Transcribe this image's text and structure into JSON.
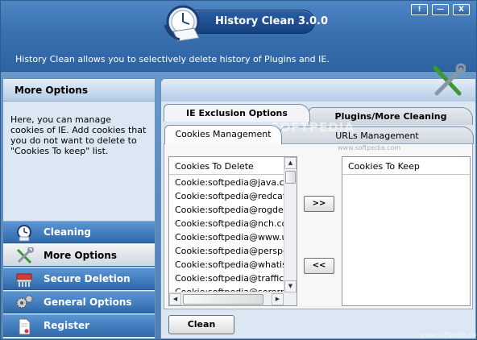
{
  "window": {
    "title": "History Clean 3.0.0",
    "subtitle": "History Clean allows you to selectively delete history of Plugins and IE.",
    "controls": {
      "info": "!",
      "minimize": "—",
      "close": "X"
    }
  },
  "left_panel": {
    "header": "More Options",
    "description": "Here, you can manage cookies of IE. Add cookies that you do not want to delete to \"Cookies To keep\" list.",
    "nav": [
      {
        "label": "Cleaning",
        "icon": "clock-icon",
        "active": false
      },
      {
        "label": "More Options",
        "icon": "tools-icon",
        "active": true
      },
      {
        "label": "Secure Deletion",
        "icon": "shredder-icon",
        "active": false
      },
      {
        "label": "General Options",
        "icon": "gears-icon",
        "active": false
      },
      {
        "label": "Register",
        "icon": "document-icon",
        "active": false
      }
    ]
  },
  "tabs": {
    "main": [
      "IE Exclusion Options",
      "Plugins/More Cleaning"
    ],
    "sub": [
      "Cookies Management",
      "URLs Management"
    ]
  },
  "cookies_to_delete": {
    "header": "Cookies To Delete",
    "items": [
      "Cookie:softpedia@java.com",
      "Cookie:softpedia@redcatsu",
      "Cookie:softpedia@rogde.ad",
      "Cookie:softpedia@nch.com.",
      "Cookie:softpedia@www.ups",
      "Cookie:softpedia@perspect",
      "Cookie:softpedia@whatismy",
      "Cookie:softpedia@trafficmp",
      "Cookie:softpedia@serorp.i"
    ]
  },
  "cookies_to_keep": {
    "header": "Cookies To Keep",
    "items": []
  },
  "buttons": {
    "move_right": ">>",
    "move_left": "<<",
    "clean": "Clean"
  },
  "watermark": {
    "text": "SOFTPEDIA",
    "url": "www.softpedia.com"
  },
  "colors": {
    "header_blue": "#3a70b0",
    "nav_blue": "#2f69ab",
    "panel_bg": "#dbe7f3"
  }
}
